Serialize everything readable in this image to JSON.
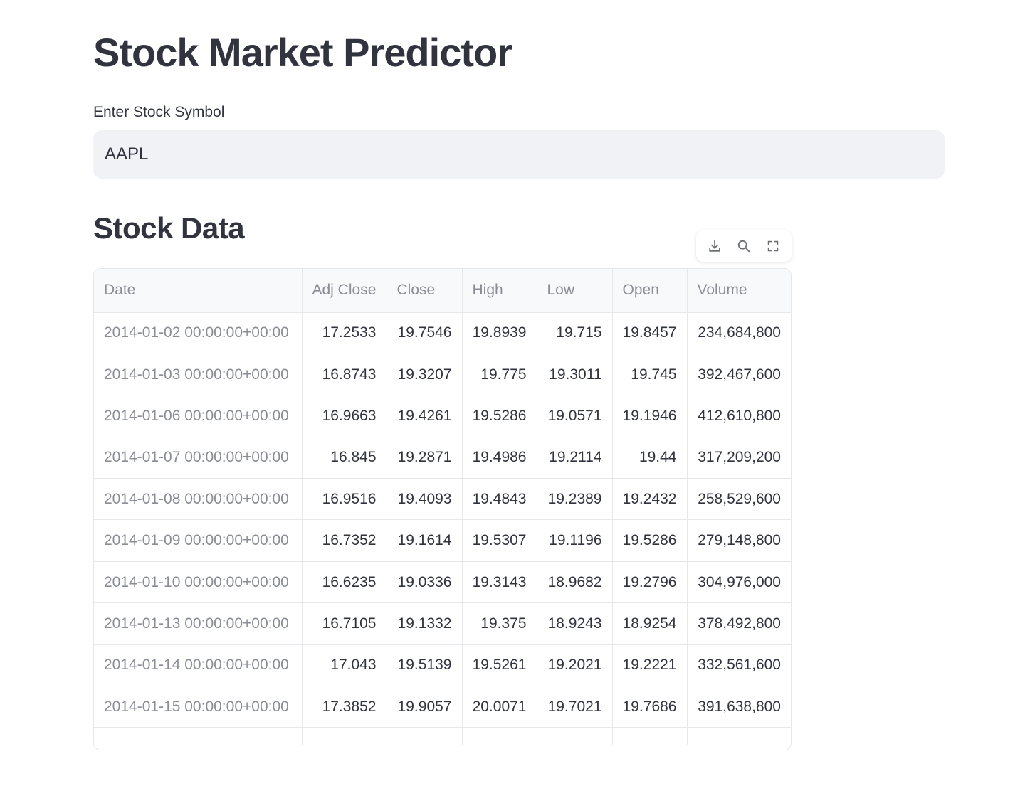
{
  "page": {
    "title": "Stock Market Predictor"
  },
  "symbol_input": {
    "label": "Enter Stock Symbol",
    "value": "AAPL"
  },
  "section": {
    "title": "Stock Data"
  },
  "toolbar": {
    "icons": [
      "download-icon",
      "search-icon",
      "fullscreen-icon"
    ]
  },
  "table": {
    "columns": [
      "Date",
      "Adj Close",
      "Close",
      "High",
      "Low",
      "Open",
      "Volume"
    ],
    "rows": [
      [
        "2014-01-02 00:00:00+00:00",
        "17.2533",
        "19.7546",
        "19.8939",
        "19.715",
        "19.8457",
        "234,684,800"
      ],
      [
        "2014-01-03 00:00:00+00:00",
        "16.8743",
        "19.3207",
        "19.775",
        "19.3011",
        "19.745",
        "392,467,600"
      ],
      [
        "2014-01-06 00:00:00+00:00",
        "16.9663",
        "19.4261",
        "19.5286",
        "19.0571",
        "19.1946",
        "412,610,800"
      ],
      [
        "2014-01-07 00:00:00+00:00",
        "16.845",
        "19.2871",
        "19.4986",
        "19.2114",
        "19.44",
        "317,209,200"
      ],
      [
        "2014-01-08 00:00:00+00:00",
        "16.9516",
        "19.4093",
        "19.4843",
        "19.2389",
        "19.2432",
        "258,529,600"
      ],
      [
        "2014-01-09 00:00:00+00:00",
        "16.7352",
        "19.1614",
        "19.5307",
        "19.1196",
        "19.5286",
        "279,148,800"
      ],
      [
        "2014-01-10 00:00:00+00:00",
        "16.6235",
        "19.0336",
        "19.3143",
        "18.9682",
        "19.2796",
        "304,976,000"
      ],
      [
        "2014-01-13 00:00:00+00:00",
        "16.7105",
        "19.1332",
        "19.375",
        "18.9243",
        "18.9254",
        "378,492,800"
      ],
      [
        "2014-01-14 00:00:00+00:00",
        "17.043",
        "19.5139",
        "19.5261",
        "19.2021",
        "19.2221",
        "332,561,600"
      ],
      [
        "2014-01-15 00:00:00+00:00",
        "17.3852",
        "19.9057",
        "20.0071",
        "19.7021",
        "19.7686",
        "391,638,800"
      ]
    ]
  }
}
